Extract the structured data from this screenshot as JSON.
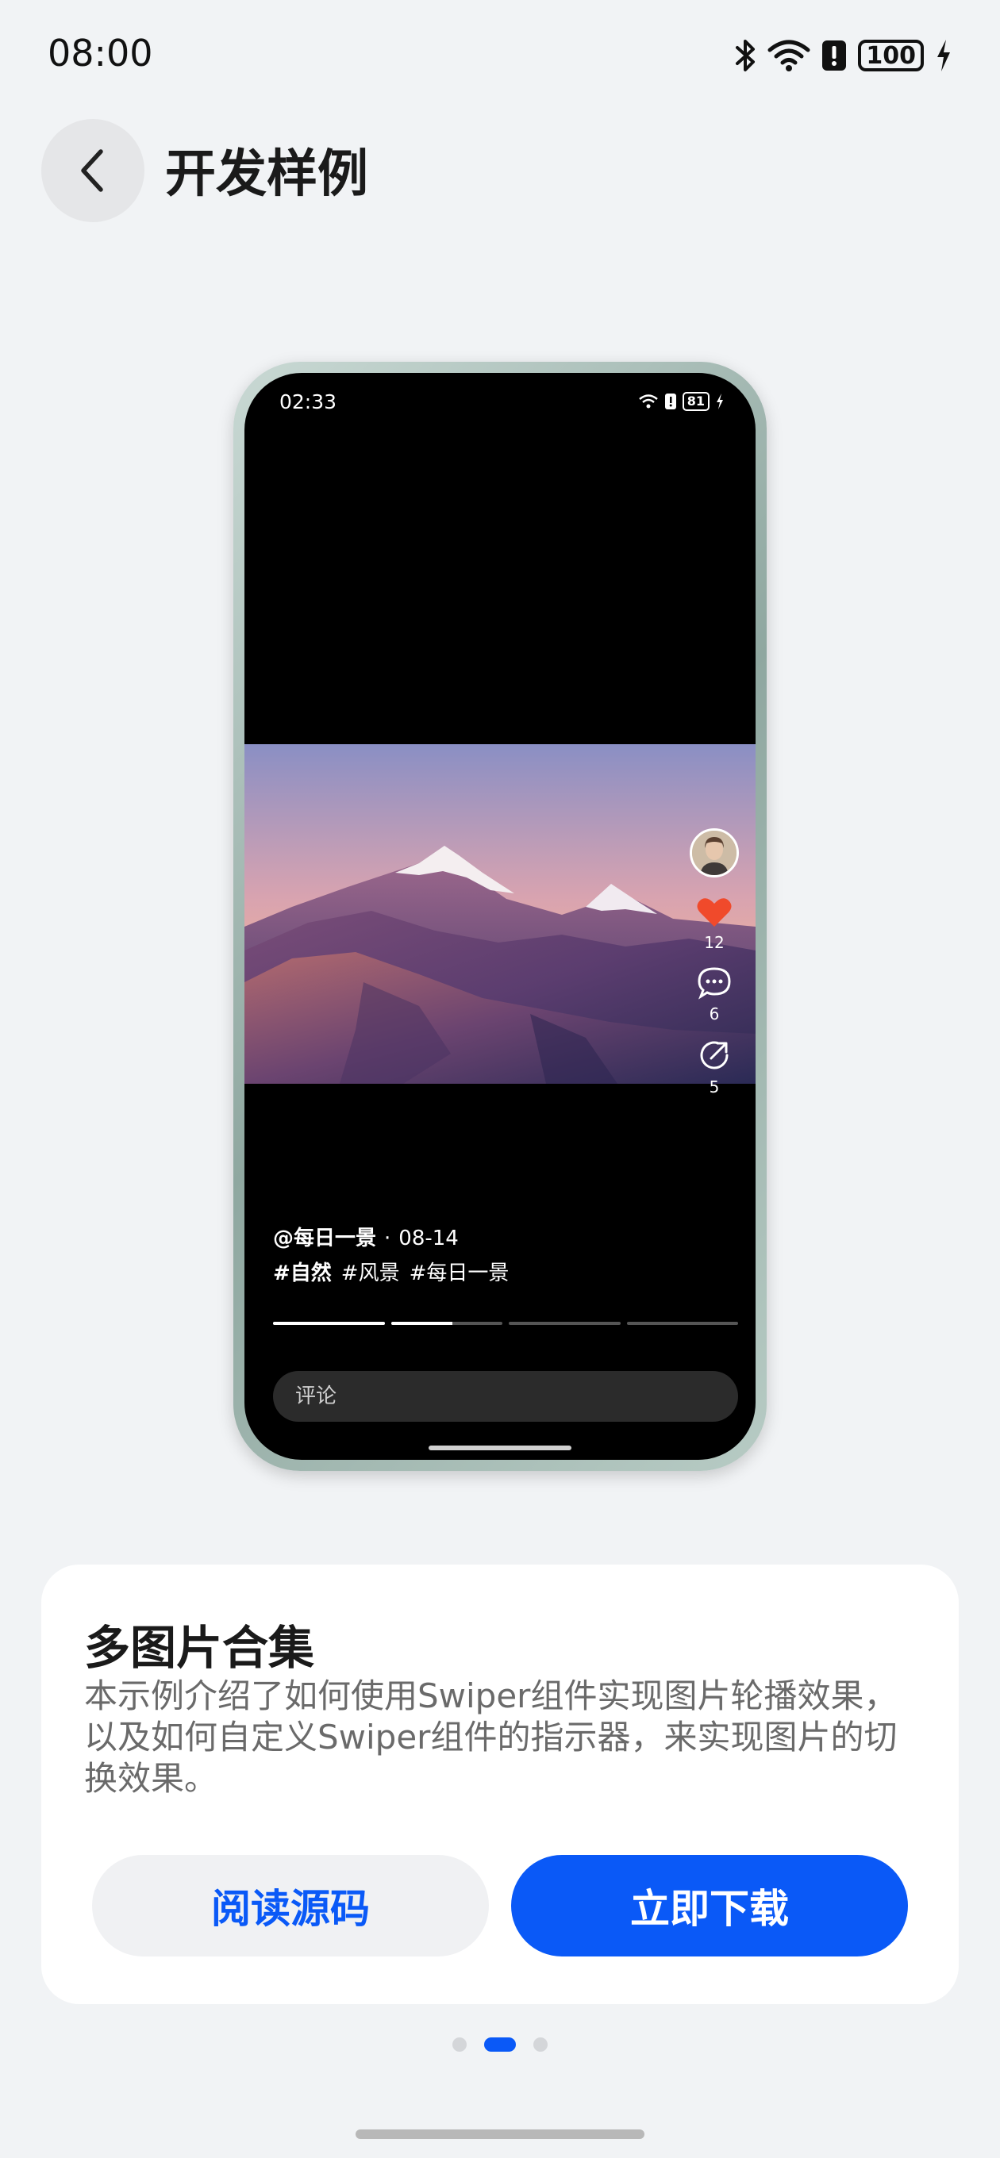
{
  "status_bar": {
    "time": "08:00",
    "battery_level": "100",
    "icons": [
      "bluetooth-icon",
      "wifi-icon",
      "alert-icon",
      "battery-icon",
      "charging-icon"
    ]
  },
  "header": {
    "back_icon": "chevron-left-icon",
    "title": "开发样例"
  },
  "preview": {
    "status_time": "02:33",
    "battery_level": "81",
    "like_count": "12",
    "comment_count": "6",
    "share_count": "5",
    "author": "@每日一景",
    "separator": "·",
    "date": "08-14",
    "tags": [
      "#自然",
      "#风景",
      "#每日一景"
    ],
    "progress": [
      1.0,
      0.55,
      0.0,
      0.0
    ],
    "comment_placeholder": "评论"
  },
  "card": {
    "title": "多图片合集",
    "description": "本示例介绍了如何使用Swiper组件实现图片轮播效果，以及如何自定义Swiper组件的指示器，来实现图片的切换效果。",
    "read_source_label": "阅读源码",
    "download_label": "立即下载"
  },
  "pager": {
    "count": 3,
    "active_index": 1
  },
  "colors": {
    "accent": "#0a59f7",
    "background": "#f1f3f5",
    "like": "#f04a2b"
  }
}
